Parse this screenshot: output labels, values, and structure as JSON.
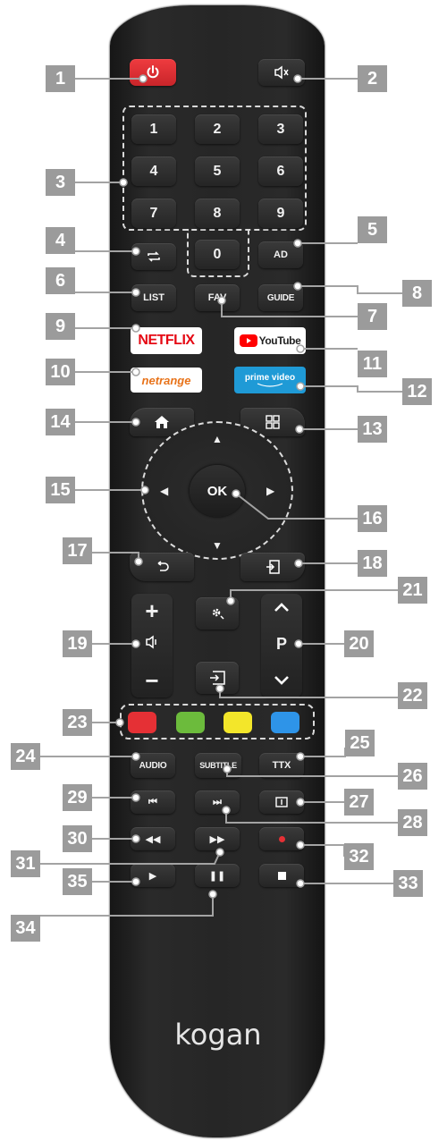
{
  "remote": {
    "brand": "kogan",
    "power_icon": "power-icon",
    "mute_icon": "mute-icon",
    "numbers": [
      "1",
      "2",
      "3",
      "4",
      "5",
      "6",
      "7",
      "8",
      "9",
      "0"
    ],
    "ad_label": "AD",
    "list_label": "LIST",
    "fav_label": "FAV",
    "guide_label": "GUIDE",
    "netflix_label": "NETFLIX",
    "youtube_label": "YouTube",
    "netrange_label": "netrange",
    "prime_label": "prime video",
    "ok_label": "OK",
    "p_label": "P",
    "vol_plus": "+",
    "vol_minus": "−",
    "audio_label": "AUDIO",
    "subtitle_label": "SUBTITLE",
    "ttx_label": "TTX",
    "colors": {
      "red": "#e53035",
      "green": "#6cbb3c",
      "yellow": "#f3e62a",
      "blue": "#2e94e8",
      "power": "#e53035"
    }
  },
  "callouts": [
    "1",
    "2",
    "3",
    "4",
    "5",
    "6",
    "7",
    "8",
    "9",
    "10",
    "11",
    "12",
    "13",
    "14",
    "15",
    "16",
    "17",
    "18",
    "19",
    "20",
    "21",
    "22",
    "23",
    "24",
    "25",
    "26",
    "27",
    "28",
    "29",
    "30",
    "31",
    "32",
    "33",
    "34",
    "35"
  ]
}
